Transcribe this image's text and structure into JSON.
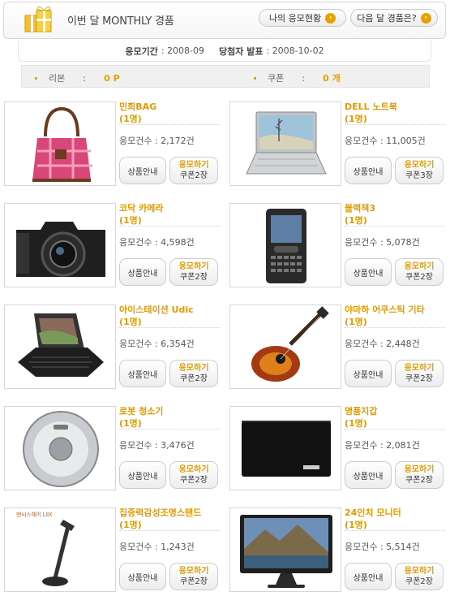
{
  "header": {
    "title": "이번 달 MONTHLY 경품",
    "my_status_label": "나의 응모현황",
    "next_month_label": "다음 달 경품은?"
  },
  "period": {
    "entry_label": "응모기간",
    "entry_value": ": 2008-09",
    "winner_label": "당첨자 발표",
    "winner_value": ": 2008-10-02"
  },
  "points": {
    "ribbon_label": "리본",
    "ribbon_sep": ":",
    "ribbon_value": "0",
    "ribbon_unit": "P",
    "coupon_label": "쿠폰",
    "coupon_sep": ":",
    "coupon_value": "0",
    "coupon_unit": "개"
  },
  "common": {
    "info_button": "상품안내",
    "apply_button": "응모하기"
  },
  "products": [
    {
      "name": "민희BAG",
      "qty": "(1명)",
      "entries": "응모건수 : 2,172건",
      "coupon": "쿠폰2장",
      "icon": "handbag-icon"
    },
    {
      "name": "DELL 노트북",
      "qty": "(1명)",
      "entries": "응모건수 : 11,005건",
      "coupon": "쿠폰3장",
      "icon": "laptop-icon"
    },
    {
      "name": "코닥 카메라",
      "qty": "(1명)",
      "entries": "응모건수 : 4,598건",
      "coupon": "쿠폰2장",
      "icon": "camera-icon"
    },
    {
      "name": "블랙잭3",
      "qty": "(1명)",
      "entries": "응모건수 : 5,078건",
      "coupon": "쿠폰2장",
      "icon": "smartphone-icon"
    },
    {
      "name": "아이스테이션 Udic",
      "qty": "(1명)",
      "entries": "응모건수 : 6,354건",
      "coupon": "쿠폰2장",
      "icon": "handheld-device-icon"
    },
    {
      "name": "야마하 어쿠스틱 기타",
      "qty": "(1명)",
      "entries": "응모건수 : 2,448건",
      "coupon": "쿠폰2장",
      "icon": "guitar-icon"
    },
    {
      "name": "로봇 청소기",
      "qty": "(1명)",
      "entries": "응모건수 : 3,476건",
      "coupon": "쿠폰2장",
      "icon": "robot-vacuum-icon"
    },
    {
      "name": "명품지갑",
      "qty": "(1명)",
      "entries": "응모건수 : 2,081건",
      "coupon": "쿠폰2장",
      "icon": "wallet-icon"
    },
    {
      "name": "집중력감성조명스탠드",
      "qty": "(1명)",
      "entries": "응모건수 : 1,243건",
      "coupon": "쿠폰2장",
      "icon": "desk-lamp-icon",
      "thumb_text": "멘씨스헤어 LIIX"
    },
    {
      "name": "24인치 모니터",
      "qty": "(1명)",
      "entries": "응모건수 : 5,514건",
      "coupon": "쿠폰2장",
      "icon": "monitor-icon"
    }
  ],
  "colors": {
    "accent": "#e19b00",
    "border": "#d6d6d6"
  }
}
